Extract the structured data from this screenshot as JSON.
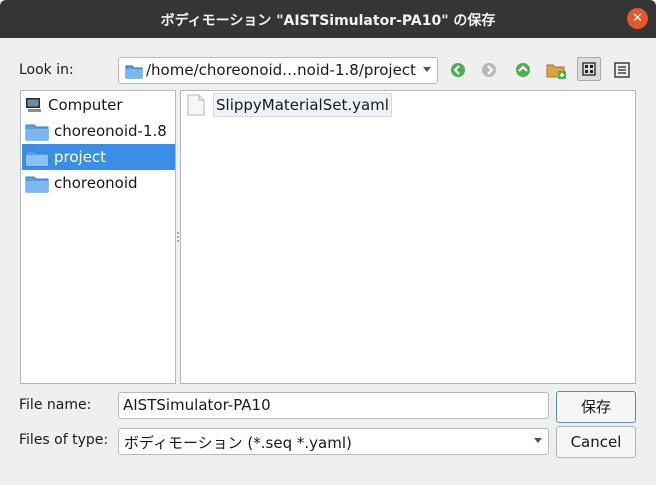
{
  "window": {
    "title": "ボディモーション \"AISTSimulator-PA10\" の保存",
    "close_glyph": "✕"
  },
  "look_in": {
    "label": "Look in:",
    "path": "/home/choreonoid…noid-1.8/project"
  },
  "toolbar": {
    "icons": [
      "back-icon",
      "forward-icon",
      "parent-directory-icon",
      "new-folder-icon",
      "list-view-icon",
      "detail-view-icon"
    ]
  },
  "sidebar": {
    "items": [
      {
        "label": "Computer",
        "icon": "computer-icon"
      },
      {
        "label": "choreonoid-1.8",
        "icon": "folder-icon"
      },
      {
        "label": "project",
        "icon": "folder-icon",
        "selected": true
      },
      {
        "label": "choreonoid",
        "icon": "folder-icon"
      }
    ]
  },
  "files": [
    {
      "name": "SlippyMaterialSet.yaml",
      "icon": "file-icon"
    }
  ],
  "file_name": {
    "label": "File name:",
    "value": "AISTSimulator-PA10"
  },
  "file_type": {
    "label": "Files of type:",
    "value": "ボディモーション (*.seq *.yaml)"
  },
  "buttons": {
    "save": "保存",
    "cancel": "Cancel"
  },
  "colors": {
    "titlebar": "#353535",
    "close": "#e6572a",
    "selection": "#3a8ee6",
    "folder": "#5aa0e0",
    "nav_green": "#4caf50"
  }
}
